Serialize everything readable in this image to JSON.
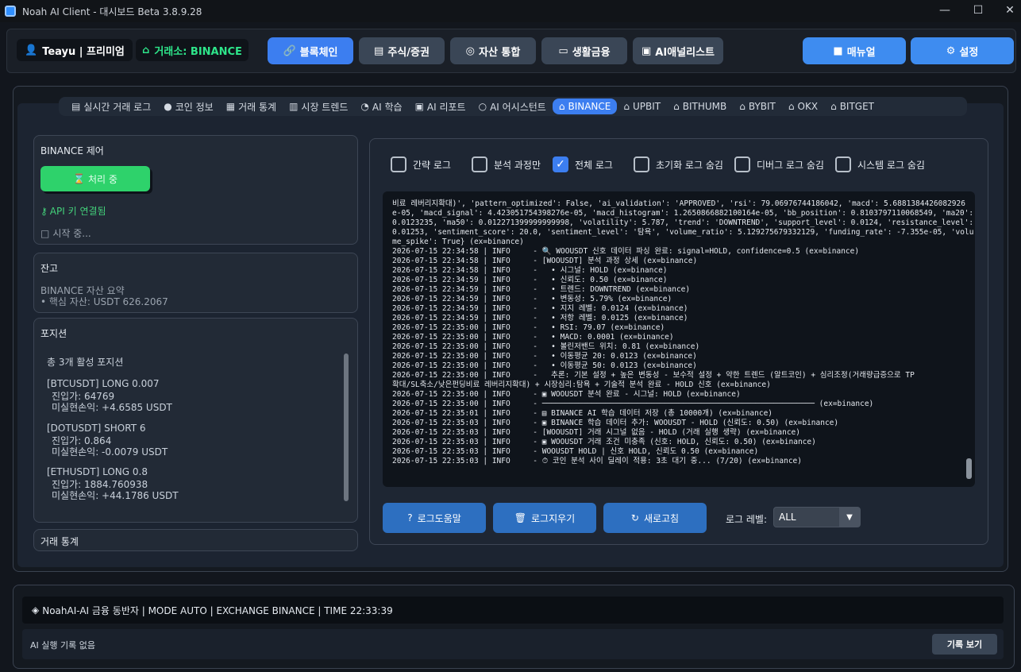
{
  "window": {
    "title": "Noah AI Client - 대시보드 Beta 3.8.9.28"
  },
  "header": {
    "user": "Teayu | 프리미엄",
    "exchange": "거래소: BINANCE",
    "nav": [
      "블록체인",
      "주식/증권",
      "자산 통합",
      "생활금융",
      "AI애널리스트"
    ],
    "manual": "매뉴얼",
    "settings": "설정"
  },
  "tabs": [
    "실시간 거래 로그",
    "코인 정보",
    "거래 통계",
    "시장 트렌드",
    "AI 학습",
    "AI 리포트",
    "AI 어시스턴트",
    "BINANCE",
    "UPBIT",
    "BITHUMB",
    "BYBIT",
    "OKX",
    "BITGET"
  ],
  "control": {
    "title": "BINANCE 제어",
    "stop_button": "처리 중",
    "api_status": "API 키 연결됨",
    "start_status": "시작 중..."
  },
  "balance": {
    "title": "잔고",
    "summary": "BINANCE 자산 요약",
    "core": "• 핵심 자산: USDT 626.2067"
  },
  "positions": {
    "title": "포지션",
    "active": "총 3개 활성 포지션",
    "items": [
      {
        "head": "[BTCUSDT] LONG 0.007",
        "entry": "진입가: 64769",
        "pnl": "미실현손익: +4.6585 USDT"
      },
      {
        "head": "[DOTUSDT] SHORT 6",
        "entry": "진입가: 0.864",
        "pnl": "미실현손익: -0.0079 USDT"
      },
      {
        "head": "[ETHUSDT] LONG 0.8",
        "entry": "진입가: 1884.760938",
        "pnl": "미실현손익: +44.1786 USDT"
      }
    ]
  },
  "stats": {
    "title": "거래 통계"
  },
  "log": {
    "checkboxes": [
      {
        "label": "간략 로그",
        "checked": false
      },
      {
        "label": "분석 과정만",
        "checked": false
      },
      {
        "label": "전체 로그",
        "checked": true
      },
      {
        "label": "초기화 로그 숨김",
        "checked": false
      },
      {
        "label": "디버그 로그 숨김",
        "checked": false
      },
      {
        "label": "시스템 로그 숨김",
        "checked": false
      }
    ],
    "lines": "비료 레버리지확대)', 'pattern_optimized': False, 'ai_validation': 'APPROVED', 'rsi': 79.06976744186042, 'macd': 5.6881384426082926\ne-05, 'macd_signal': 4.423051754398276e-05, 'macd_histogram': 1.2650866882100164e-05, 'bb_position': 0.8103797110068549, 'ma20':\n0.0123235, 'ma50': 0.012271399999999998, 'volatility': 5.787, 'trend': 'DOWNTREND', 'support_level': 0.0124, 'resistance_level':\n0.01253, 'sentiment_score': 20.0, 'sentiment_level': '탐욕', 'volume_ratio': 5.129275679332129, 'funding_rate': -7.355e-05, 'volu\nme_spike': True} (ex=binance)\n2026-07-15 22:34:58 | INFO     - 🔍 WOOUSDT 신호 데이터 파싱 완료: signal=HOLD, confidence=0.5 (ex=binance)\n2026-07-15 22:34:58 | INFO     - [WOOUSDT] 분석 과정 상세 (ex=binance)\n2026-07-15 22:34:58 | INFO     -   • 시그널: HOLD (ex=binance)\n2026-07-15 22:34:59 | INFO     -   • 신뢰도: 0.50 (ex=binance)\n2026-07-15 22:34:59 | INFO     -   • 트렌드: DOWNTREND (ex=binance)\n2026-07-15 22:34:59 | INFO     -   • 변동성: 5.79% (ex=binance)\n2026-07-15 22:34:59 | INFO     -   • 지지 레벨: 0.0124 (ex=binance)\n2026-07-15 22:34:59 | INFO     -   • 저항 레벨: 0.0125 (ex=binance)\n2026-07-15 22:35:00 | INFO     -   • RSI: 79.07 (ex=binance)\n2026-07-15 22:35:00 | INFO     -   • MACD: 0.0001 (ex=binance)\n2026-07-15 22:35:00 | INFO     -   • 볼린저밴드 위치: 0.81 (ex=binance)\n2026-07-15 22:35:00 | INFO     -   • 이동평균 20: 0.0123 (ex=binance)\n2026-07-15 22:35:00 | INFO     -   • 이동평균 50: 0.0123 (ex=binance)\n2026-07-15 22:35:00 | INFO     -   추론: 기본 설정 + 높은 변동성 - 보수적 설정 + 약한 트렌드 (알트코인) + 심리조정(거래량급증으로 TP\n확대/SL축소/낮은펀딩비료 레버리지확대) + 시장심리:탐욕 + 기술적 분석 완료 - HOLD 신호 (ex=binance)\n2026-07-15 22:35:00 | INFO     - ▣ WOOUSDT 분석 완료 - 시그널: HOLD (ex=binance)\n2026-07-15 22:35:00 | INFO     - ──────────────────────────────────────────────────────────── (ex=binance)\n2026-07-15 22:35:01 | INFO     - ▤ BINANCE AI 학습 데이터 저장 (총 10000개) (ex=binance)\n2026-07-15 22:35:03 | INFO     - ▣ BINANCE 학습 데이터 추가: WOOUSDT - HOLD (신뢰도: 0.50) (ex=binance)\n2026-07-15 22:35:03 | INFO     - [WOOUSDT] 거래 시그널 없음 - HOLD (거래 실행 생략) (ex=binance)\n2026-07-15 22:35:03 | INFO     - ▣ WOOUSDT 거래 조건 미충족 (신호: HOLD, 신뢰도: 0.50) (ex=binance)\n2026-07-15 22:35:03 | INFO     - WOOUSDT HOLD | 신호 HOLD, 신뢰도 0.50 (ex=binance)\n2026-07-15 22:35:03 | INFO     - ⏱ 코인 분석 사이 딜레이 적용: 3초 대기 중... (7/20) (ex=binance)",
    "buttons": [
      "로그도움말",
      "로그지우기",
      "새로고침"
    ],
    "level_label": "로그 레벨:",
    "level_value": "ALL"
  },
  "status": {
    "line": "NoahAI-AI 금융 동반자 | MODE AUTO | EXCHANGE BINANCE | TIME 22:33:39",
    "history": "AI 실행 기록 없음",
    "history_button": "기록 보기"
  },
  "colors": {
    "accent": "#3c7ef0",
    "green": "#2ed26b",
    "panel": "#222a36",
    "log_bg": "#0f141b"
  }
}
